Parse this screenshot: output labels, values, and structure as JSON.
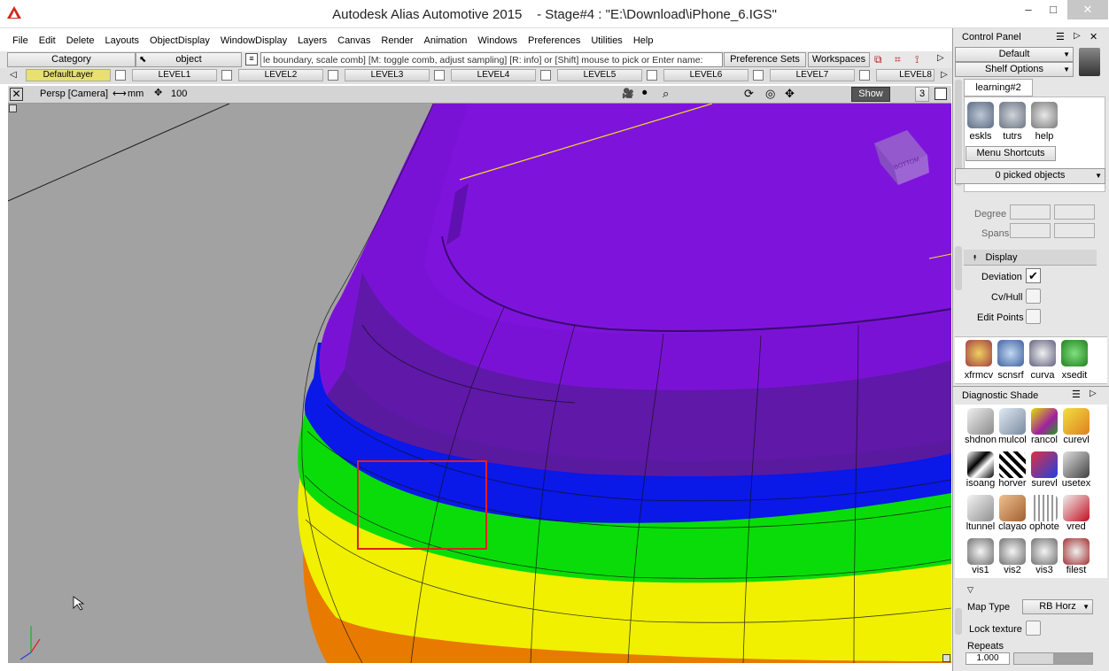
{
  "title_bar": {
    "app": "Autodesk Alias Automotive 2015",
    "document": "- Stage#4 : \"E:\\Download\\iPhone_6.IGS\"",
    "minimize": "–",
    "maximize": "□",
    "close": "✕"
  },
  "menu": [
    "File",
    "Edit",
    "Delete",
    "Layouts",
    "ObjectDisplay",
    "WindowDisplay",
    "Layers",
    "Canvas",
    "Render",
    "Animation",
    "Windows",
    "Preferences",
    "Utilities",
    "Help"
  ],
  "toolbar": {
    "category": "Category",
    "object": "object",
    "prompt": "le boundary, scale comb] [M: toggle comb, adjust sampling] [R: info] or [Shift] mouse to pick or Enter name:",
    "preference_sets": "Preference Sets",
    "workspaces": "Workspaces"
  },
  "layers": [
    "DefaultLayer",
    "LEVEL1",
    "LEVEL2",
    "LEVEL3",
    "LEVEL4",
    "LEVEL5",
    "LEVEL6",
    "LEVEL7",
    "LEVEL8"
  ],
  "viewport": {
    "label": "Persp [Camera]",
    "units": "mm",
    "zoom": "100",
    "show": "Show",
    "count": "3",
    "viewcube_face": "BOTTOM"
  },
  "control_panel": {
    "title": "Control Panel",
    "default": "Default",
    "shelf_options": "Shelf Options",
    "shelf_tab": "learning#2",
    "shelf_items": [
      "eskls",
      "tutrs",
      "help"
    ],
    "menu_shortcuts": "Menu Shortcuts",
    "picked": "0 picked objects",
    "degree": "Degree",
    "spans": "Spans",
    "display": "Display",
    "deviation": "Deviation",
    "cv_hull": "Cv/Hull",
    "edit_points": "Edit Points",
    "tool_items": [
      "xfrmcv",
      "scnsrf",
      "curva",
      "xsedit"
    ]
  },
  "diagnostic_shade": {
    "title": "Diagnostic Shade",
    "items": [
      "shdnon",
      "mulcol",
      "rancol",
      "curevl",
      "isoang",
      "horver",
      "surevl",
      "usetex",
      "ltunnel",
      "clayao",
      "ophote",
      "vred",
      "vis1",
      "vis2",
      "vis3",
      "filest"
    ],
    "map_type_label": "Map Type",
    "map_type_value": "RB Horz",
    "lock_texture": "Lock texture",
    "repeats": "Repeats",
    "repeats_value": "1.000"
  },
  "colors": {
    "purple": "#7a12d6",
    "dark_purple": "#5a1aa0",
    "blue": "#0a18e8",
    "green": "#0adc0a",
    "yellow": "#f0f000",
    "orange": "#e87a00",
    "highlight": "#e02020",
    "layer_active": "#e8e070"
  }
}
